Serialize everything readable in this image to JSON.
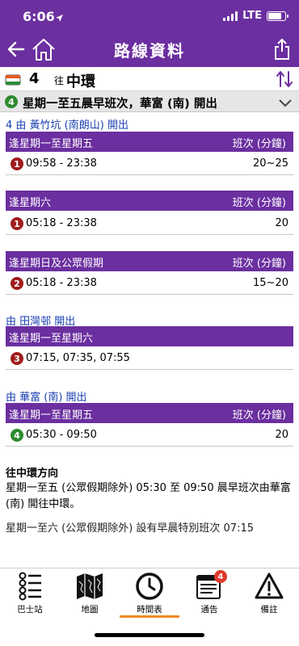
{
  "status_bar": {
    "time": "6:06",
    "network": "LTE"
  },
  "nav": {
    "title": "路線資料"
  },
  "route": {
    "number": "4",
    "to_prefix": "往",
    "destination": "中環"
  },
  "notice": {
    "badge": "4",
    "text": "星期一至五晨早班次，華富 (南) 開出"
  },
  "sections": [
    {
      "origin": "4 由 黃竹坑 (南朗山) 開出",
      "groups": [
        {
          "day": "逢星期一至星期五",
          "freq_header": "班次 (分鐘)",
          "row": {
            "badge": "1",
            "times": "09:58 - 23:38",
            "freq": "20~25"
          }
        },
        {
          "day": "逢星期六",
          "freq_header": "班次 (分鐘)",
          "row": {
            "badge": "1",
            "times": "05:18 - 23:38",
            "freq": "20"
          }
        },
        {
          "day": "逢星期日及公眾假期",
          "freq_header": "班次 (分鐘)",
          "row": {
            "badge": "2",
            "times": "05:18 - 23:38",
            "freq": "15~20"
          }
        }
      ]
    },
    {
      "origin": "由 田灣邨 開出",
      "groups": [
        {
          "day": "逢星期一至星期六",
          "freq_header": "",
          "row": {
            "badge": "3",
            "times": "07:15, 07:35, 07:55",
            "freq": ""
          }
        }
      ]
    },
    {
      "origin": "由 華富 (南) 開出",
      "groups": [
        {
          "day": "逢星期一至星期五",
          "freq_header": "班次 (分鐘)",
          "row": {
            "badge": "4",
            "times": "05:30 - 09:50",
            "freq": "20"
          }
        }
      ]
    }
  ],
  "info": {
    "title": "往中環方向",
    "text": "星期一至五 (公眾假期除外) 05:30 至 09:50 晨早班次由華富 (南) 開往中環。",
    "text_cut": "星期一至六 (公眾假期除外) 設有早晨特別班次 07:15"
  },
  "tabs": [
    {
      "label": "巴士站",
      "icon": "bus-stop-icon"
    },
    {
      "label": "地圖",
      "icon": "map-icon"
    },
    {
      "label": "時間表",
      "icon": "clock-icon",
      "active": true
    },
    {
      "label": "通告",
      "icon": "notice-icon",
      "badge": "4"
    },
    {
      "label": "備註",
      "icon": "warning-icon"
    }
  ],
  "colors": {
    "primary": "#6b2fa0",
    "link": "#1a3fb0",
    "active_tab": "#f08a24",
    "badge_red": "#a01c1c",
    "badge_green": "#2e8b2e"
  }
}
